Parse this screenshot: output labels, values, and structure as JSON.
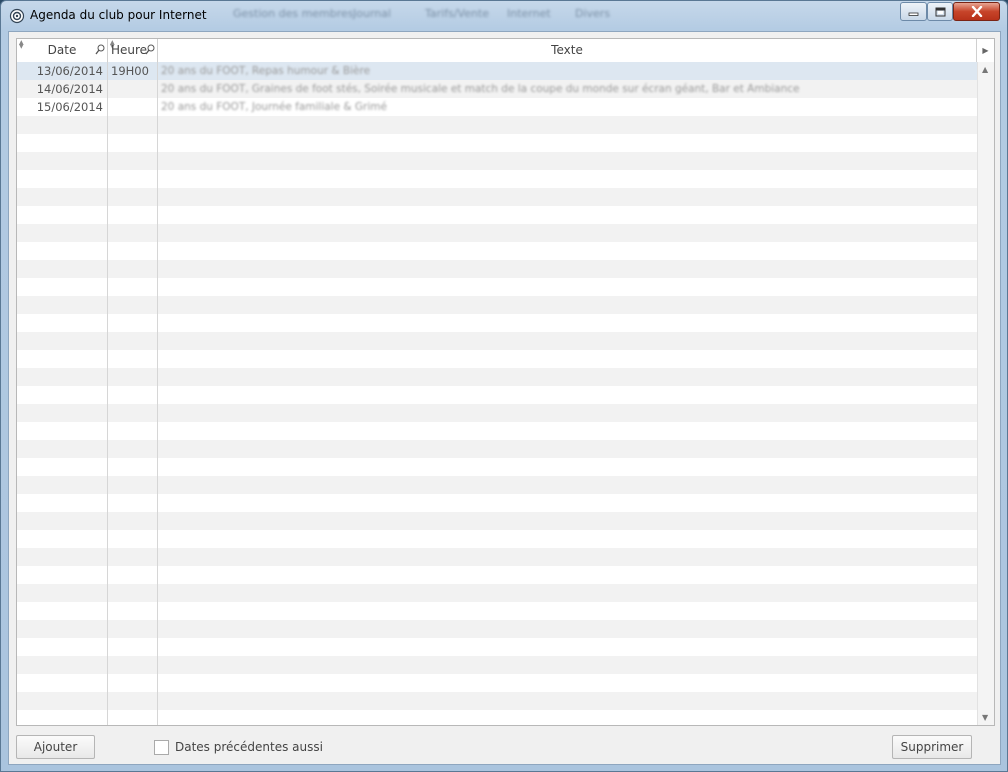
{
  "window": {
    "title": "Agenda du club pour Internet",
    "background_menu": [
      "Gestion des membres",
      "Journal",
      "Tarifs/Vente",
      "Internet",
      "Divers"
    ]
  },
  "grid": {
    "columns": {
      "date": "Date",
      "heure": "Heure",
      "texte": "Texte"
    },
    "rows": [
      {
        "date": "13/06/2014",
        "heure": "19H00",
        "texte": "20 ans du FOOT, Repas humour & Bière"
      },
      {
        "date": "14/06/2014",
        "heure": "",
        "texte": "20 ans du FOOT, Graines de foot stés, Soirée musicale et match de la coupe du monde sur écran géant, Bar et Ambiance"
      },
      {
        "date": "15/06/2014",
        "heure": "",
        "texte": "20 ans du FOOT, Journée familiale & Grimé"
      }
    ]
  },
  "footer": {
    "add_label": "Ajouter",
    "checkbox_label": "Dates précédentes aussi",
    "checkbox_checked": false,
    "delete_label": "Supprimer"
  },
  "colors": {
    "selected_row": "#dde7f1",
    "alt_row": "#f2f2f2",
    "close_button": "#c7442a"
  }
}
